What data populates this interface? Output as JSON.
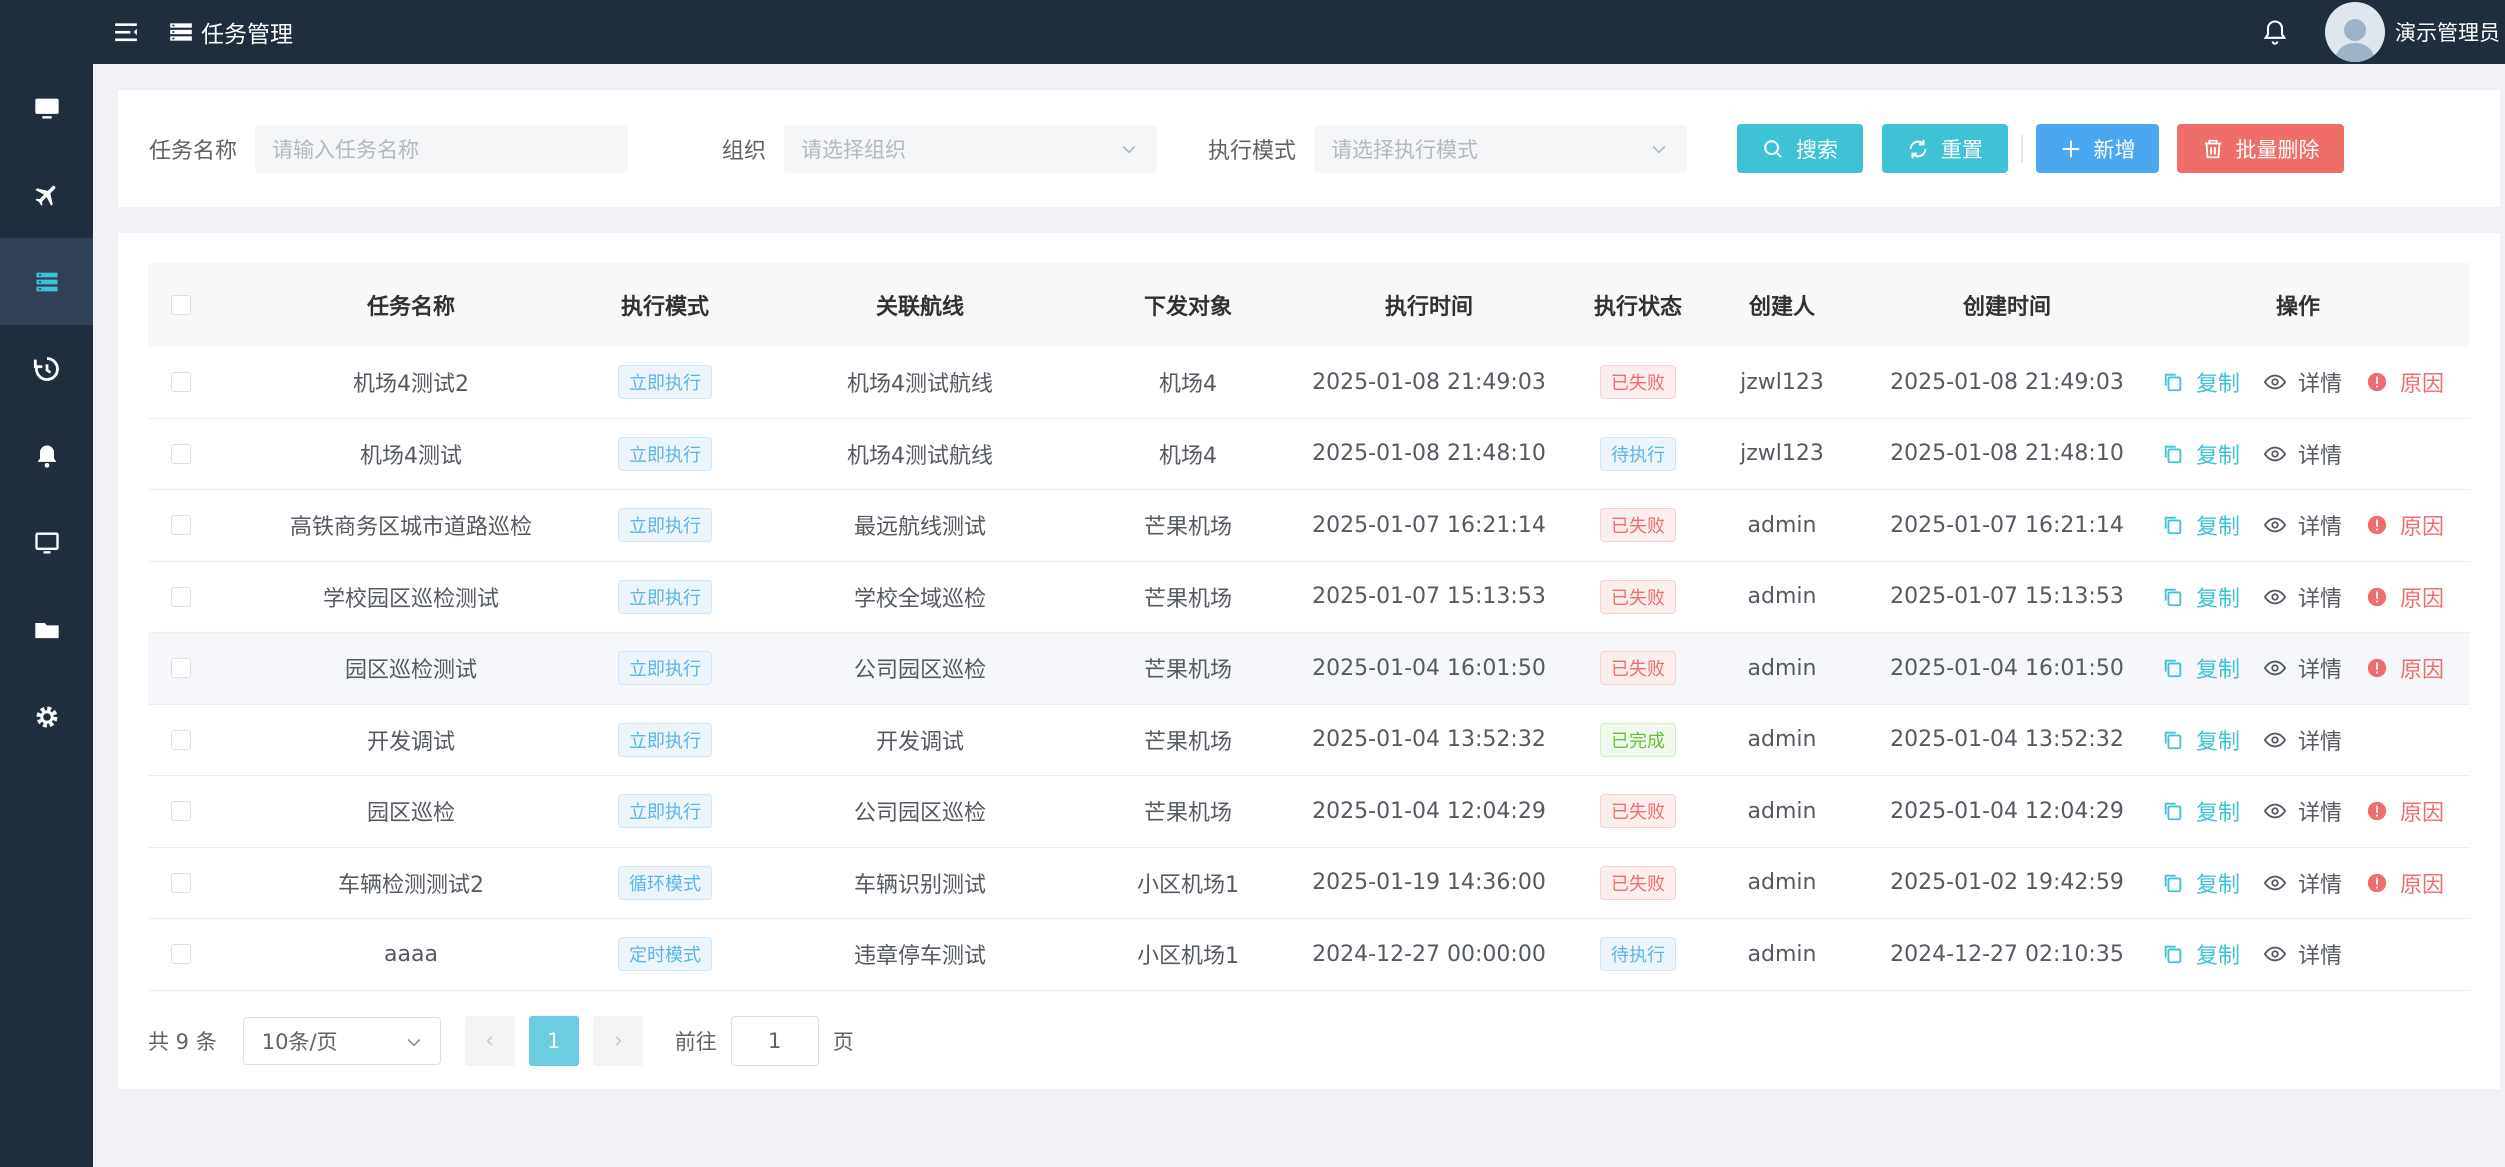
{
  "header": {
    "title": "任务管理",
    "user_name": "演示管理员"
  },
  "sidebar": {
    "items": [
      {
        "icon": "monitor-icon"
      },
      {
        "icon": "airplane-icon"
      },
      {
        "icon": "task-list-icon",
        "active": true
      },
      {
        "icon": "history-icon"
      },
      {
        "icon": "bell-icon"
      },
      {
        "icon": "screen-icon"
      },
      {
        "icon": "folder-icon"
      },
      {
        "icon": "gear-icon"
      }
    ]
  },
  "search": {
    "task_name_label": "任务名称",
    "task_name_placeholder": "请输入任务名称",
    "org_label": "组织",
    "org_placeholder": "请选择组织",
    "mode_label": "执行模式",
    "mode_placeholder": "请选择执行模式",
    "search_btn": "搜索",
    "reset_btn": "重置",
    "add_btn": "新增",
    "batch_delete_btn": "批量删除"
  },
  "table": {
    "columns": [
      "任务名称",
      "执行模式",
      "关联航线",
      "下发对象",
      "执行时间",
      "执行状态",
      "创建人",
      "创建时间",
      "操作"
    ],
    "op_copy": "复制",
    "op_detail": "详情",
    "op_reason": "原因",
    "rows": [
      {
        "name": "机场4测试2",
        "mode": "立即执行",
        "route": "机场4测试航线",
        "target": "机场4",
        "time": "2025-01-08 21:49:03",
        "status": "已失败",
        "creator": "jzwl123",
        "ctime": "2025-01-08 21:49:03"
      },
      {
        "name": "机场4测试",
        "mode": "立即执行",
        "route": "机场4测试航线",
        "target": "机场4",
        "time": "2025-01-08 21:48:10",
        "status": "待执行",
        "creator": "jzwl123",
        "ctime": "2025-01-08 21:48:10"
      },
      {
        "name": "高铁商务区城市道路巡检",
        "mode": "立即执行",
        "route": "最远航线测试",
        "target": "芒果机场",
        "time": "2025-01-07 16:21:14",
        "status": "已失败",
        "creator": "admin",
        "ctime": "2025-01-07 16:21:14"
      },
      {
        "name": "学校园区巡检测试",
        "mode": "立即执行",
        "route": "学校全域巡检",
        "target": "芒果机场",
        "time": "2025-01-07 15:13:53",
        "status": "已失败",
        "creator": "admin",
        "ctime": "2025-01-07 15:13:53"
      },
      {
        "name": "园区巡检测试",
        "mode": "立即执行",
        "route": "公司园区巡检",
        "target": "芒果机场",
        "time": "2025-01-04 16:01:50",
        "status": "已失败",
        "creator": "admin",
        "ctime": "2025-01-04 16:01:50"
      },
      {
        "name": "开发调试",
        "mode": "立即执行",
        "route": "开发调试",
        "target": "芒果机场",
        "time": "2025-01-04 13:52:32",
        "status": "已完成",
        "creator": "admin",
        "ctime": "2025-01-04 13:52:32"
      },
      {
        "name": "园区巡检",
        "mode": "立即执行",
        "route": "公司园区巡检",
        "target": "芒果机场",
        "time": "2025-01-04 12:04:29",
        "status": "已失败",
        "creator": "admin",
        "ctime": "2025-01-04 12:04:29"
      },
      {
        "name": "车辆检测测试2",
        "mode": "循环模式",
        "route": "车辆识别测试",
        "target": "小区机场1",
        "time": "2025-01-19 14:36:00",
        "status": "已失败",
        "creator": "admin",
        "ctime": "2025-01-02 19:42:59"
      },
      {
        "name": "aaaa",
        "mode": "定时模式",
        "route": "违章停车测试",
        "target": "小区机场1",
        "time": "2024-12-27 00:00:00",
        "status": "待执行",
        "creator": "admin",
        "ctime": "2024-12-27 02:10:35"
      }
    ]
  },
  "pagination": {
    "total": "共 9 条",
    "page_size": "10条/页",
    "current_page": "1",
    "goto_label": "前往",
    "goto_value": "1",
    "page_unit": "页"
  },
  "colors": {
    "primary": "#3ec3d6",
    "add": "#4ba7f0",
    "danger": "#ef6f68",
    "sidebar": "#1f2d3d"
  }
}
